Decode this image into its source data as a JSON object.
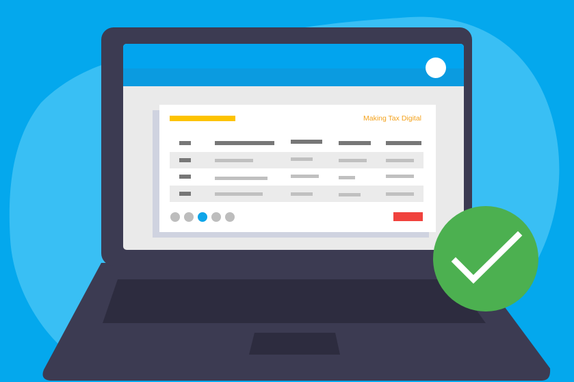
{
  "card": {
    "brand_label": "Making Tax Digital"
  },
  "table": {
    "rows": 4,
    "columns": 5
  },
  "pagination": {
    "dots": 5,
    "active_index": 2
  },
  "status": {
    "state": "success",
    "icon": "checkmark-icon"
  },
  "colors": {
    "background": "#04a8ed",
    "blob": "#39bff4",
    "laptop_body": "#3c3b52",
    "window_header": "#02a4ee",
    "accent_yellow": "#fdc300",
    "brand_text": "#f4a21c",
    "active_dot": "#0ea5e9",
    "action_red": "#f0423d",
    "check_badge": "#4cb050"
  }
}
